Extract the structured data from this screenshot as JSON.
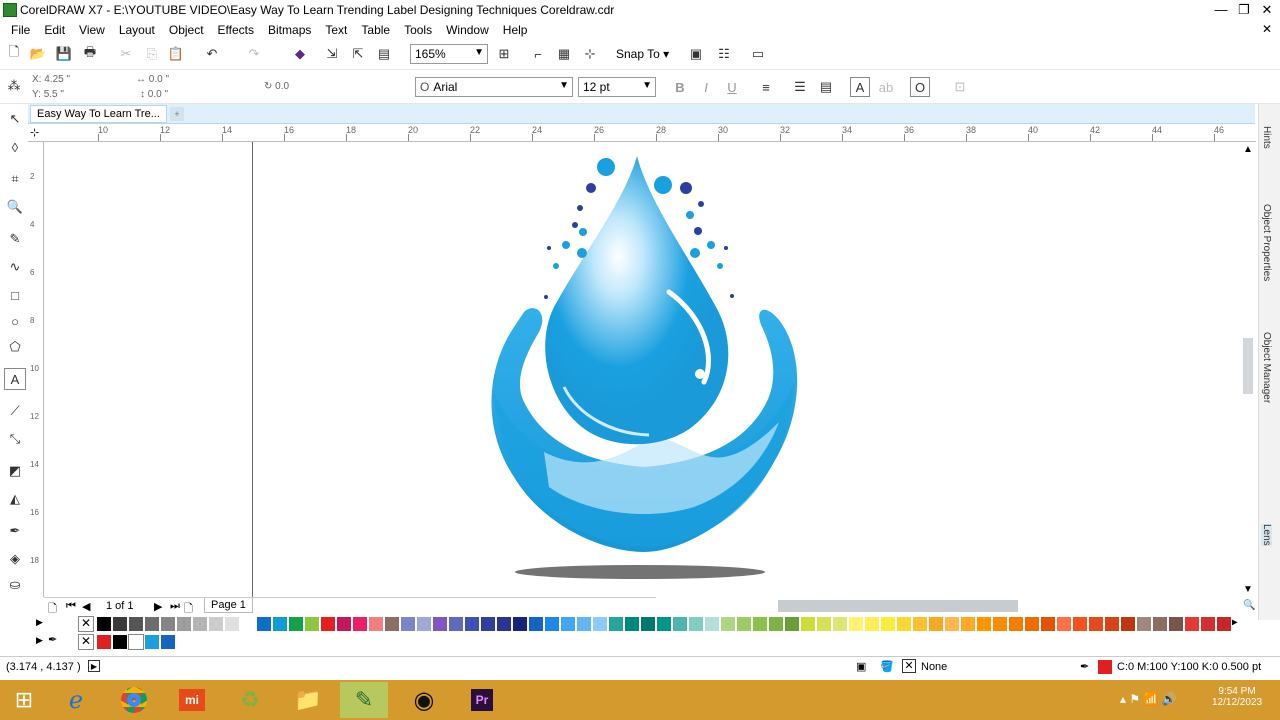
{
  "window": {
    "title": "CorelDRAW X7 - E:\\YOUTUBE VIDEO\\Easy Way To Learn Trending Label Designing Techniques Coreldraw.cdr"
  },
  "menu": [
    "File",
    "Edit",
    "View",
    "Layout",
    "Object",
    "Effects",
    "Bitmaps",
    "Text",
    "Table",
    "Tools",
    "Window",
    "Help"
  ],
  "toolbar": {
    "zoom": "165%",
    "snap_to": "Snap To"
  },
  "property_bar": {
    "x": "4.25 \"",
    "y": "5.5 \"",
    "w": "0.0 \"",
    "h": "0.0 \"",
    "angle": "0.0",
    "font": "Arial",
    "font_size": "12 pt"
  },
  "document_tab": "Easy Way To Learn Tre...",
  "ruler": {
    "h": [
      "10",
      "12",
      "14",
      "16",
      "18",
      "20",
      "22",
      "24",
      "26",
      "28",
      "30",
      "32",
      "34",
      "36",
      "38",
      "40",
      "42",
      "44",
      "46"
    ],
    "v": [
      "2",
      "4",
      "6",
      "8",
      "10",
      "12",
      "14",
      "16",
      "18"
    ]
  },
  "right_dock": [
    "Hints",
    "Object Properties",
    "Object Manager",
    "Lens"
  ],
  "page_nav": {
    "count": "1 of 1",
    "tab": "Page 1"
  },
  "palette": {
    "colors": [
      "#000000",
      "#3a3a3a",
      "#555555",
      "#6d6d6d",
      "#858585",
      "#9d9d9d",
      "#b5b5b5",
      "#cccccc",
      "#e0e0e0",
      "#ffffff",
      "#0f6fc4",
      "#0f9bd5",
      "#11a34b",
      "#8dc63f",
      "#e62020",
      "#c2185b",
      "#e91e63",
      "#f08080",
      "#8d6e63",
      "#7986cb",
      "#9fa8da",
      "#7e57c2",
      "#5c6bc0",
      "#3f51b5",
      "#303f9f",
      "#283593",
      "#1a237e",
      "#1565c0",
      "#1e88e5",
      "#42a5f5",
      "#64b5f6",
      "#90caf9",
      "#26a69a",
      "#00897b",
      "#00796b",
      "#009688",
      "#4db6ac",
      "#80cbc4",
      "#b2dfdb",
      "#aed581",
      "#9ccc65",
      "#8bc34a",
      "#7cb342",
      "#689f38",
      "#cddc39",
      "#d4e157",
      "#dce775",
      "#fff176",
      "#ffee58",
      "#ffeb3b",
      "#fdd835",
      "#fbc02d",
      "#f9a825",
      "#ffb74d",
      "#ffa726",
      "#ff9800",
      "#fb8c00",
      "#f57c00",
      "#ef6c00",
      "#e65100",
      "#ff7043",
      "#f4511e",
      "#e64a19",
      "#d84315",
      "#bf360c",
      "#a1887f",
      "#8d6e63",
      "#795548",
      "#e53935",
      "#d32f2f",
      "#c62828"
    ],
    "doc_colors": [
      "#e02020",
      "#000000",
      "#ffffff",
      "#1aa0e0",
      "#1565c0"
    ]
  },
  "status": {
    "coords": "(3.174 , 4.137 )",
    "fill": "None",
    "outline": "C:0 M:100 Y:100 K:0  0.500 pt",
    "outline_color": "#e02020"
  },
  "clock": {
    "time": "9:54 PM",
    "date": "12/12/2023"
  },
  "colors": {
    "drop": "#1aa0e0",
    "drop_light": "#bfe7fb",
    "dots_dark": "#2b3f9e",
    "taskbar": "#d59a2d"
  }
}
